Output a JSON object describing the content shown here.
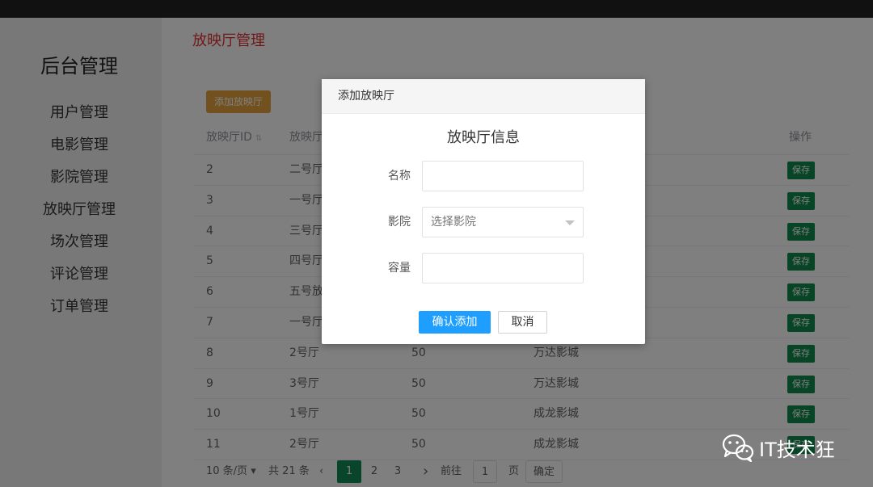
{
  "sidebar": {
    "brand": "后台管理",
    "items": [
      {
        "label": "用户管理"
      },
      {
        "label": "电影管理"
      },
      {
        "label": "影院管理"
      },
      {
        "label": "放映厅管理"
      },
      {
        "label": "场次管理"
      },
      {
        "label": "评论管理"
      },
      {
        "label": "订单管理"
      }
    ]
  },
  "page": {
    "title": "放映厅管理",
    "add_button": "添加放映厅"
  },
  "table": {
    "headers": {
      "id": "放映厅ID",
      "name": "放映厅",
      "action": "操作"
    },
    "save_label": "保存",
    "rows": [
      {
        "id": "2",
        "name": "二号厅",
        "capacity": "",
        "cinema": ""
      },
      {
        "id": "3",
        "name": "一号厅",
        "capacity": "",
        "cinema": ""
      },
      {
        "id": "4",
        "name": "三号厅",
        "capacity": "",
        "cinema": ""
      },
      {
        "id": "5",
        "name": "四号厅",
        "capacity": "",
        "cinema": ""
      },
      {
        "id": "6",
        "name": "五号放",
        "capacity": "",
        "cinema": ""
      },
      {
        "id": "7",
        "name": "一号厅",
        "capacity": "",
        "cinema": ""
      },
      {
        "id": "8",
        "name": "2号厅",
        "capacity": "50",
        "cinema": "万达影城"
      },
      {
        "id": "9",
        "name": "3号厅",
        "capacity": "50",
        "cinema": "万达影城"
      },
      {
        "id": "10",
        "name": "1号厅",
        "capacity": "50",
        "cinema": "成龙影城"
      },
      {
        "id": "11",
        "name": "2号厅",
        "capacity": "50",
        "cinema": "成龙影城"
      }
    ]
  },
  "pager": {
    "page_size": "10 条/页",
    "total": "共 21 条",
    "pages": [
      "1",
      "2",
      "3"
    ],
    "goto_label": "前往",
    "goto_value": "1",
    "page_unit": "页",
    "confirm": "确定"
  },
  "dialog": {
    "title": "添加放映厅",
    "subtitle": "放映厅信息",
    "name_label": "名称",
    "name_value": "",
    "cinema_label": "影院",
    "cinema_placeholder": "选择影院",
    "capacity_label": "容量",
    "capacity_value": "",
    "confirm_label": "确认添加",
    "cancel_label": "取消"
  },
  "watermark": {
    "text": "IT技术狂"
  }
}
